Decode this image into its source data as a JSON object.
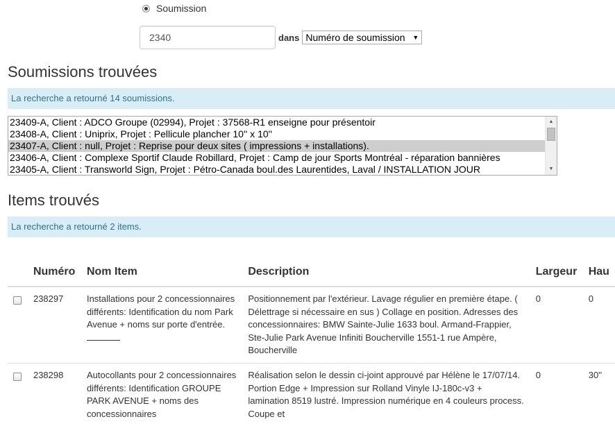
{
  "search": {
    "radio_label": "Soumission",
    "query_value": "2340",
    "dans_label": "dans",
    "field_select": "Numéro de soumission"
  },
  "soumissions": {
    "heading": "Soumissions trouvées",
    "result_text": "La recherche a retourné 14 soumissions.",
    "options": [
      "23409-A, Client : ADCO Groupe (02994), Projet : 37568-R1 enseigne pour présentoir",
      "23408-A, Client : Uniprix, Projet : Pellicule plancher 10'' x 10''",
      "23407-A, Client : null, Projet : Reprise pour deux sites ( impressions + installations).",
      "23406-A, Client : Complexe Sportif Claude Robillard, Projet : Camp de jour Sports Montréal - réparation bannières",
      "23405-A, Client : Transworld Sign, Projet : Pétro-Canada boul.des Laurentides, Laval / INSTALLATION JOUR"
    ],
    "selected_index": 2
  },
  "items": {
    "heading": "Items trouvés",
    "result_text": "La recherche a retourné 2 items.",
    "columns": [
      "Numéro",
      "Nom Item",
      "Description",
      "Largeur",
      "Hau"
    ],
    "rows": [
      {
        "numero": "238297",
        "nom": "Installations pour 2 concessionnaires différents: Identification du nom Park Avenue + noms sur porte d'entrée.",
        "description": "Positionnement par l'extérieur. Lavage régulier en première étape. ( Délettrage si nécessaire en sus ) Collage en position. Adresses des concessionnaires: BMW Sainte-Julie 1633 boul. Armand-Frappier, Ste-Julie Park Avenue Infiniti Boucherville 1551-1 rue Ampère, Boucherville",
        "largeur": "0",
        "hauteur": "0"
      },
      {
        "numero": "238298",
        "nom": "Autocollants pour 2 concessionnaires différents: Identification GROUPE PARK AVENUE + noms des concessionnaires",
        "description": "Réalisation selon le dessin ci-joint approuvé par Hélène le 17/07/14. Portion Edge + Impression sur Rolland Vinyle IJ-180c-v3 + lamination 8519 lustré. Impression numérique en 4 couleurs process. Coupe et",
        "largeur": "0",
        "hauteur": "30''"
      }
    ]
  }
}
